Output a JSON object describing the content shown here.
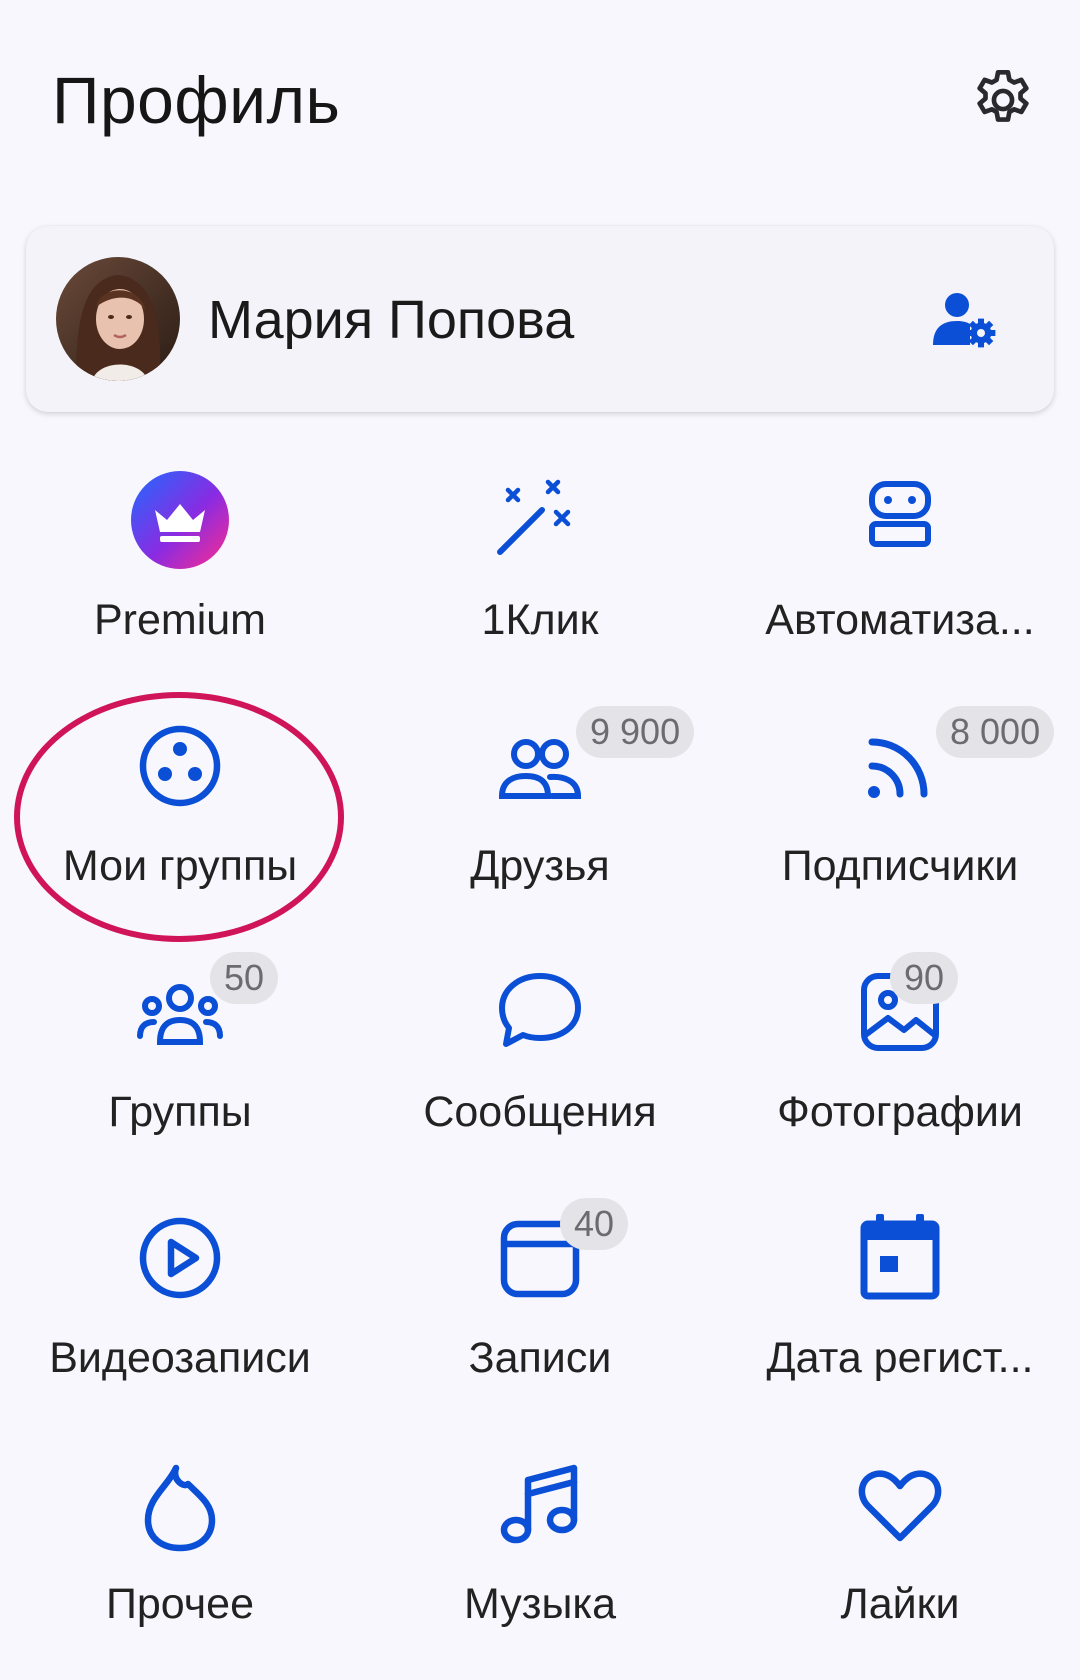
{
  "header": {
    "title": "Профиль",
    "settings_icon": "gear-icon"
  },
  "profile": {
    "name": "Мария Попова",
    "edit_icon": "user-settings-icon"
  },
  "accent": "#0a4fd6",
  "menu": [
    {
      "label": "Premium",
      "icon": "crown-icon",
      "badge": ""
    },
    {
      "label": "1Клик",
      "icon": "magic-wand-icon",
      "badge": ""
    },
    {
      "label": "Автоматиза...",
      "icon": "robot-icon",
      "badge": ""
    },
    {
      "label": "Мои группы",
      "icon": "community-icon",
      "badge": ""
    },
    {
      "label": "Друзья",
      "icon": "friends-icon",
      "badge": "9 900"
    },
    {
      "label": "Подписчики",
      "icon": "feed-icon",
      "badge": "8 000"
    },
    {
      "label": "Группы",
      "icon": "groups-icon",
      "badge": "50"
    },
    {
      "label": "Сообщения",
      "icon": "message-icon",
      "badge": ""
    },
    {
      "label": "Фотографии",
      "icon": "photo-icon",
      "badge": "90"
    },
    {
      "label": "Видеозаписи",
      "icon": "play-icon",
      "badge": ""
    },
    {
      "label": "Записи",
      "icon": "post-icon",
      "badge": "40"
    },
    {
      "label": "Дата регист...",
      "icon": "calendar-icon",
      "badge": ""
    },
    {
      "label": "Прочее",
      "icon": "flame-icon",
      "badge": ""
    },
    {
      "label": "Музыка",
      "icon": "music-icon",
      "badge": ""
    },
    {
      "label": "Лайки",
      "icon": "heart-icon",
      "badge": ""
    }
  ]
}
